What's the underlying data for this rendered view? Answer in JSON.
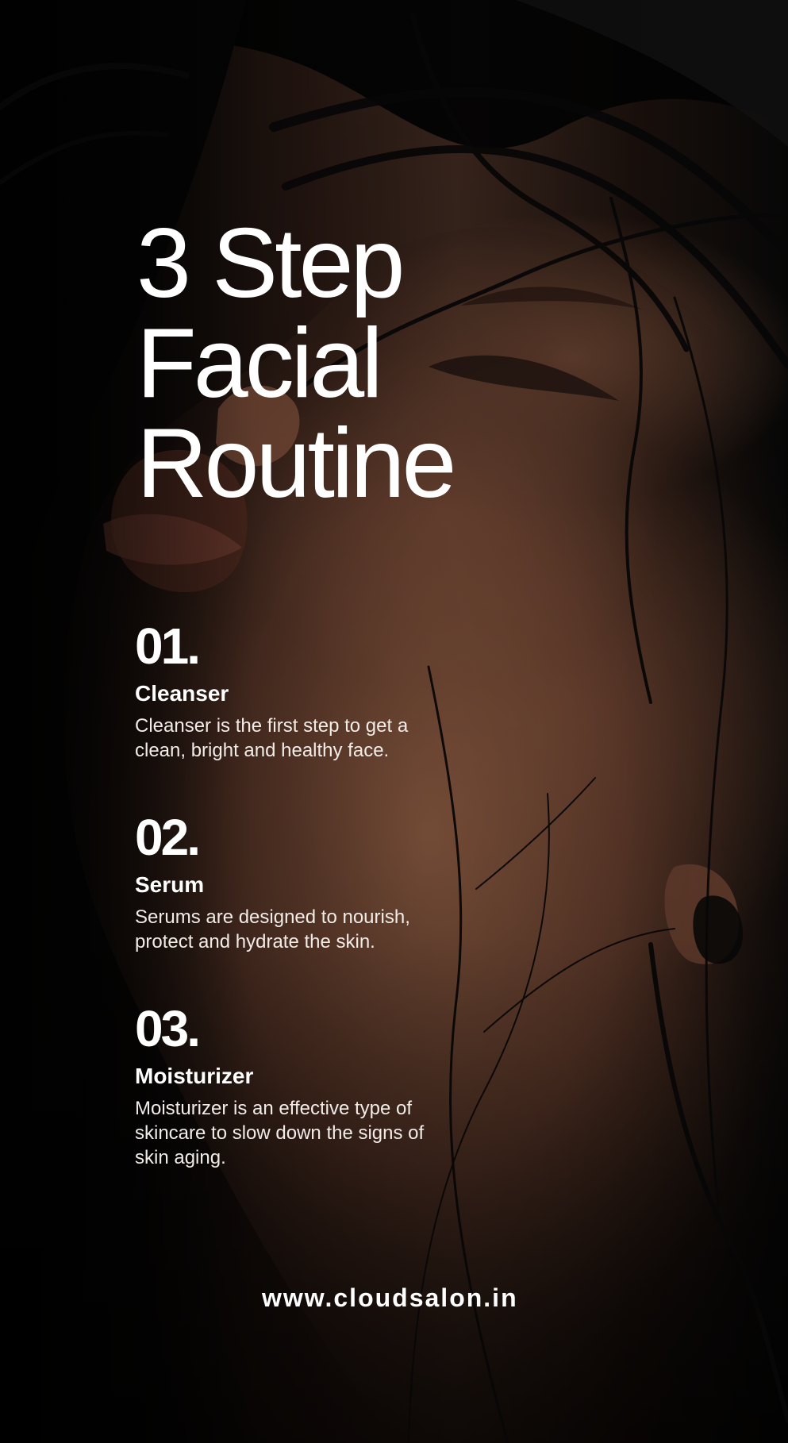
{
  "poster": {
    "title_lines": [
      "3 Step",
      "Facial",
      "Routine"
    ],
    "steps": [
      {
        "number": "01.",
        "name": "Cleanser",
        "description": "Cleanser is the first step to get a clean, bright and healthy face."
      },
      {
        "number": "02.",
        "name": "Serum",
        "description": "Serums are designed to nourish, protect and hydrate the skin."
      },
      {
        "number": "03.",
        "name": "Moisturizer",
        "description": "Moisturizer is an effective type of skincare to slow down the signs of skin aging."
      }
    ],
    "website": "www.cloudsalon.in"
  },
  "colors": {
    "background": "#050505",
    "text": "#ffffff",
    "body_text": "#f2ece8",
    "skin_warm": "#7a4b36",
    "hair": "#0b0908"
  },
  "icons": {
    "background_image": "face-portrait-illustration"
  }
}
